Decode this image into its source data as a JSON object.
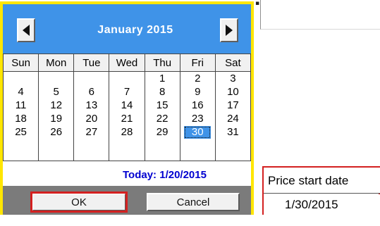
{
  "calendar": {
    "month_title": "January 2015",
    "prev_icon": "triangle-left-icon",
    "next_icon": "triangle-right-icon",
    "weekdays": [
      "Sun",
      "Mon",
      "Tue",
      "Wed",
      "Thu",
      "Fri",
      "Sat"
    ],
    "weeks": [
      [
        "",
        "",
        "",
        "",
        "1",
        "2",
        "3"
      ],
      [
        "4",
        "5",
        "6",
        "7",
        "8",
        "9",
        "10"
      ],
      [
        "11",
        "12",
        "13",
        "14",
        "15",
        "16",
        "17"
      ],
      [
        "18",
        "19",
        "20",
        "21",
        "22",
        "23",
        "24"
      ],
      [
        "25",
        "26",
        "27",
        "28",
        "29",
        "30",
        "31"
      ]
    ],
    "selected_day": "30",
    "today_label": "Today: 1/20/2015",
    "ok_label": "OK",
    "cancel_label": "Cancel",
    "colors": {
      "header": "#3f93e8",
      "border": "#ffe600",
      "footer": "#7b7b7b",
      "today": "#0000d0",
      "ok_outline": "#d32020",
      "selected": "#3f93e8"
    }
  },
  "field": {
    "label": "Price start date",
    "value": "1/30/2015",
    "highlight": "#d32020"
  }
}
